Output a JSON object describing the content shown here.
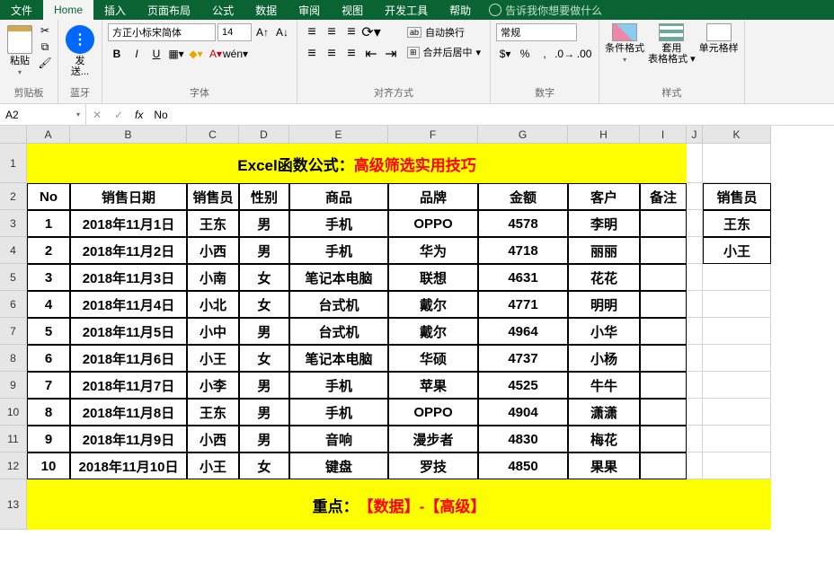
{
  "tabs": {
    "file": "文件",
    "home": "Home",
    "insert": "插入",
    "layout": "页面布局",
    "formula": "公式",
    "data": "数据",
    "review": "审阅",
    "view": "视图",
    "dev": "开发工具",
    "help": "帮助",
    "tellme": "告诉我你想要做什么"
  },
  "ribbon": {
    "clipboard": {
      "paste": "粘贴",
      "title": "剪贴板"
    },
    "bluetooth": {
      "send": "发\n送...",
      "title": "蓝牙"
    },
    "font": {
      "name": "方正小标宋简体",
      "size": "14",
      "title": "字体"
    },
    "align": {
      "wrap": "自动换行",
      "merge": "合并后居中",
      "title": "对齐方式"
    },
    "number": {
      "format": "常规",
      "title": "数字"
    },
    "styles": {
      "cond": "条件格式",
      "table": "套用\n表格格式",
      "cell": "单元格样",
      "title": "样式"
    }
  },
  "nameBox": "A2",
  "formulaValue": "No",
  "banner": {
    "black": "Excel函数公式：",
    "red": "高级筛选实用技巧"
  },
  "headers": {
    "no": "No",
    "date": "销售日期",
    "sales": "销售员",
    "gender": "性别",
    "product": "商品",
    "brand": "品牌",
    "amount": "金额",
    "customer": "客户",
    "note": "备注"
  },
  "rows": [
    {
      "no": "1",
      "date": "2018年11月1日",
      "sales": "王东",
      "gender": "男",
      "product": "手机",
      "brand": "OPPO",
      "amount": "4578",
      "customer": "李明",
      "note": ""
    },
    {
      "no": "2",
      "date": "2018年11月2日",
      "sales": "小西",
      "gender": "男",
      "product": "手机",
      "brand": "华为",
      "amount": "4718",
      "customer": "丽丽",
      "note": ""
    },
    {
      "no": "3",
      "date": "2018年11月3日",
      "sales": "小南",
      "gender": "女",
      "product": "笔记本电脑",
      "brand": "联想",
      "amount": "4631",
      "customer": "花花",
      "note": ""
    },
    {
      "no": "4",
      "date": "2018年11月4日",
      "sales": "小北",
      "gender": "女",
      "product": "台式机",
      "brand": "戴尔",
      "amount": "4771",
      "customer": "明明",
      "note": ""
    },
    {
      "no": "5",
      "date": "2018年11月5日",
      "sales": "小中",
      "gender": "男",
      "product": "台式机",
      "brand": "戴尔",
      "amount": "4964",
      "customer": "小华",
      "note": ""
    },
    {
      "no": "6",
      "date": "2018年11月6日",
      "sales": "小王",
      "gender": "女",
      "product": "笔记本电脑",
      "brand": "华硕",
      "amount": "4737",
      "customer": "小杨",
      "note": ""
    },
    {
      "no": "7",
      "date": "2018年11月7日",
      "sales": "小李",
      "gender": "男",
      "product": "手机",
      "brand": "苹果",
      "amount": "4525",
      "customer": "牛牛",
      "note": ""
    },
    {
      "no": "8",
      "date": "2018年11月8日",
      "sales": "王东",
      "gender": "男",
      "product": "手机",
      "brand": "OPPO",
      "amount": "4904",
      "customer": "潇潇",
      "note": ""
    },
    {
      "no": "9",
      "date": "2018年11月9日",
      "sales": "小西",
      "gender": "男",
      "product": "音响",
      "brand": "漫步者",
      "amount": "4830",
      "customer": "梅花",
      "note": ""
    },
    {
      "no": "10",
      "date": "2018年11月10日",
      "sales": "小王",
      "gender": "女",
      "product": "键盘",
      "brand": "罗技",
      "amount": "4850",
      "customer": "果果",
      "note": ""
    }
  ],
  "sideK": {
    "header": "销售员",
    "v1": "王东",
    "v2": "小王"
  },
  "footer": {
    "black": "重点：",
    "red": "【数据】-【高级】"
  },
  "cols": [
    "A",
    "B",
    "C",
    "D",
    "E",
    "F",
    "G",
    "H",
    "I",
    "J",
    "K"
  ],
  "rowNums": [
    "1",
    "2",
    "3",
    "4",
    "5",
    "6",
    "7",
    "8",
    "9",
    "10",
    "11",
    "12",
    "13"
  ]
}
